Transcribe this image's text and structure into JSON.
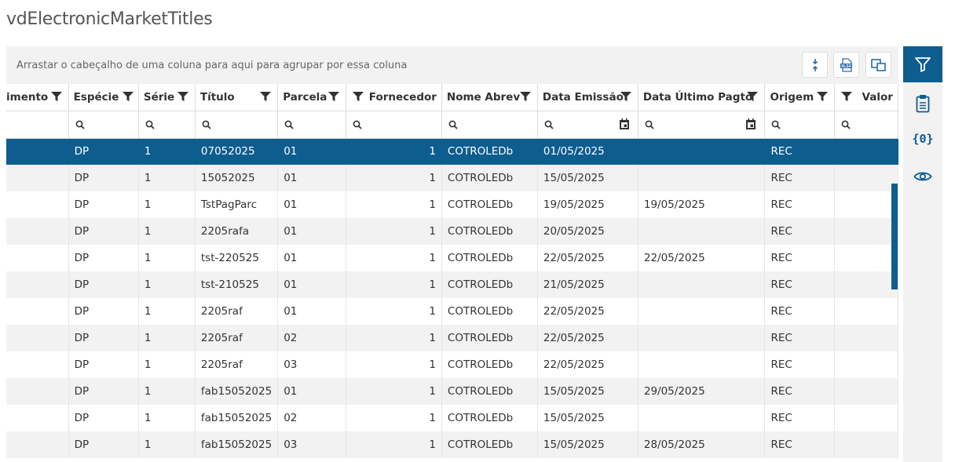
{
  "page": {
    "title": "vdElectronicMarketTitles"
  },
  "group_panel": {
    "text": "Arrastar o cabeçalho de uma coluna para aqui para agrupar por essa coluna"
  },
  "toolbar": {
    "icons": [
      "column-chooser-icon",
      "xlsx-export-icon",
      "layout-icon"
    ]
  },
  "sidebar": {
    "icons": [
      "filter-icon",
      "clipboard-icon",
      "variables-icon",
      "eye-icon"
    ],
    "accent": "#0d5d8f"
  },
  "columns": [
    "imento",
    "Espécie",
    "Série",
    "Título",
    "Parcela",
    "Fornecedor",
    "Nome Abrev",
    "Data Emissão",
    "Data Último Pagto",
    "Origem",
    "Valor"
  ],
  "rows": [
    {
      "especie": "DP",
      "serie": "1",
      "titulo": "07052025",
      "parcela": "01",
      "fornecedor": "1",
      "nome": "COTROLEDb",
      "emissao": "01/05/2025",
      "ultimo": "",
      "origem": "REC"
    },
    {
      "especie": "DP",
      "serie": "1",
      "titulo": "15052025",
      "parcela": "01",
      "fornecedor": "1",
      "nome": "COTROLEDb",
      "emissao": "15/05/2025",
      "ultimo": "",
      "origem": "REC"
    },
    {
      "especie": "DP",
      "serie": "1",
      "titulo": "TstPagParc",
      "parcela": "01",
      "fornecedor": "1",
      "nome": "COTROLEDb",
      "emissao": "19/05/2025",
      "ultimo": "19/05/2025",
      "origem": "REC"
    },
    {
      "especie": "DP",
      "serie": "1",
      "titulo": "2205rafa",
      "parcela": "01",
      "fornecedor": "1",
      "nome": "COTROLEDb",
      "emissao": "20/05/2025",
      "ultimo": "",
      "origem": "REC"
    },
    {
      "especie": "DP",
      "serie": "1",
      "titulo": "tst-220525",
      "parcela": "01",
      "fornecedor": "1",
      "nome": "COTROLEDb",
      "emissao": "22/05/2025",
      "ultimo": "22/05/2025",
      "origem": "REC"
    },
    {
      "especie": "DP",
      "serie": "1",
      "titulo": "tst-210525",
      "parcela": "01",
      "fornecedor": "1",
      "nome": "COTROLEDb",
      "emissao": "21/05/2025",
      "ultimo": "",
      "origem": "REC"
    },
    {
      "especie": "DP",
      "serie": "1",
      "titulo": "2205raf",
      "parcela": "01",
      "fornecedor": "1",
      "nome": "COTROLEDb",
      "emissao": "22/05/2025",
      "ultimo": "",
      "origem": "REC"
    },
    {
      "especie": "DP",
      "serie": "1",
      "titulo": "2205raf",
      "parcela": "02",
      "fornecedor": "1",
      "nome": "COTROLEDb",
      "emissao": "22/05/2025",
      "ultimo": "",
      "origem": "REC"
    },
    {
      "especie": "DP",
      "serie": "1",
      "titulo": "2205raf",
      "parcela": "03",
      "fornecedor": "1",
      "nome": "COTROLEDb",
      "emissao": "22/05/2025",
      "ultimo": "",
      "origem": "REC"
    },
    {
      "especie": "DP",
      "serie": "1",
      "titulo": "fab15052025",
      "parcela": "01",
      "fornecedor": "1",
      "nome": "COTROLEDb",
      "emissao": "15/05/2025",
      "ultimo": "29/05/2025",
      "origem": "REC"
    },
    {
      "especie": "DP",
      "serie": "1",
      "titulo": "fab15052025",
      "parcela": "02",
      "fornecedor": "1",
      "nome": "COTROLEDb",
      "emissao": "15/05/2025",
      "ultimo": "",
      "origem": "REC"
    },
    {
      "especie": "DP",
      "serie": "1",
      "titulo": "fab15052025",
      "parcela": "03",
      "fornecedor": "1",
      "nome": "COTROLEDb",
      "emissao": "15/05/2025",
      "ultimo": "28/05/2025",
      "origem": "REC"
    }
  ]
}
